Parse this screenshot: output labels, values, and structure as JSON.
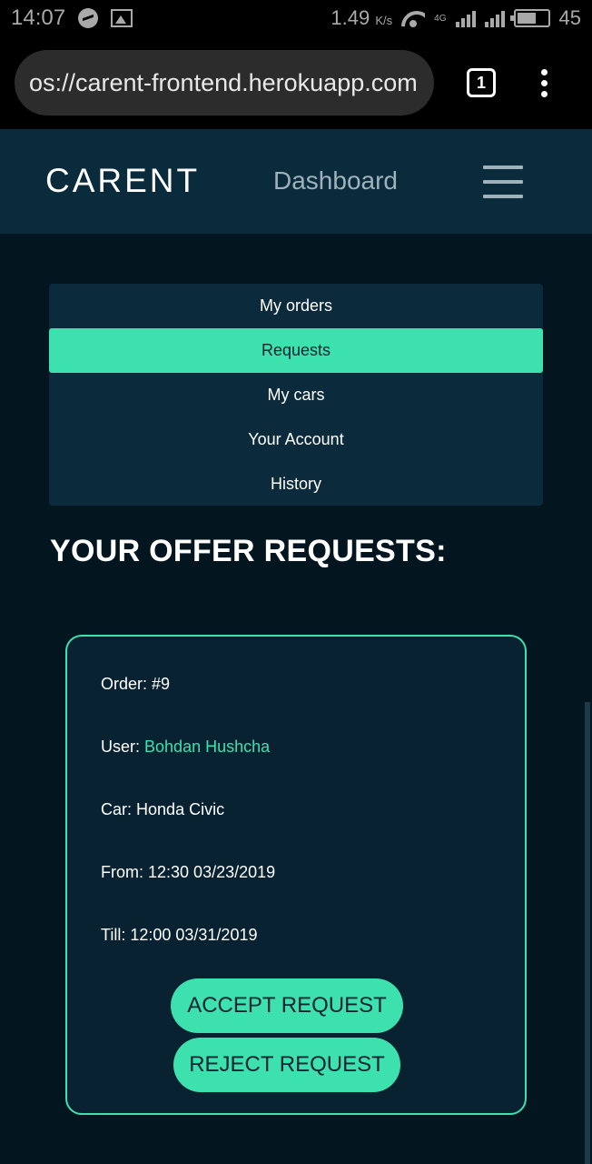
{
  "status_bar": {
    "time": "14:07",
    "speed": "1.49",
    "speed_unit": "K/s",
    "network": "4G",
    "battery": "45"
  },
  "browser": {
    "url": "os://carent-frontend.herokuapp.com",
    "tab_count": "1"
  },
  "nav": {
    "brand": "CARENT",
    "dashboard": "Dashboard"
  },
  "menu": {
    "items": [
      {
        "label": "My orders"
      },
      {
        "label": "Requests"
      },
      {
        "label": "My cars"
      },
      {
        "label": "Your Account"
      },
      {
        "label": "History"
      }
    ],
    "active": "Requests"
  },
  "page": {
    "heading": "YOUR OFFER REQUESTS:"
  },
  "request": {
    "order_label": "Order:",
    "order_value": "#9",
    "user_label": "User:",
    "user_value": "Bohdan Hushcha",
    "car_label": "Car:",
    "car_value": "Honda Civic",
    "from_label": "From:",
    "from_value": "12:30 03/23/2019",
    "till_label": "Till:",
    "till_value": "12:00 03/31/2019",
    "accept_label": "ACCEPT REQUEST",
    "reject_label": "REJECT REQUEST"
  },
  "colors": {
    "accent": "#3ce1ad",
    "background": "#031620",
    "navbar": "#0a2b3b",
    "card": "#082231"
  }
}
